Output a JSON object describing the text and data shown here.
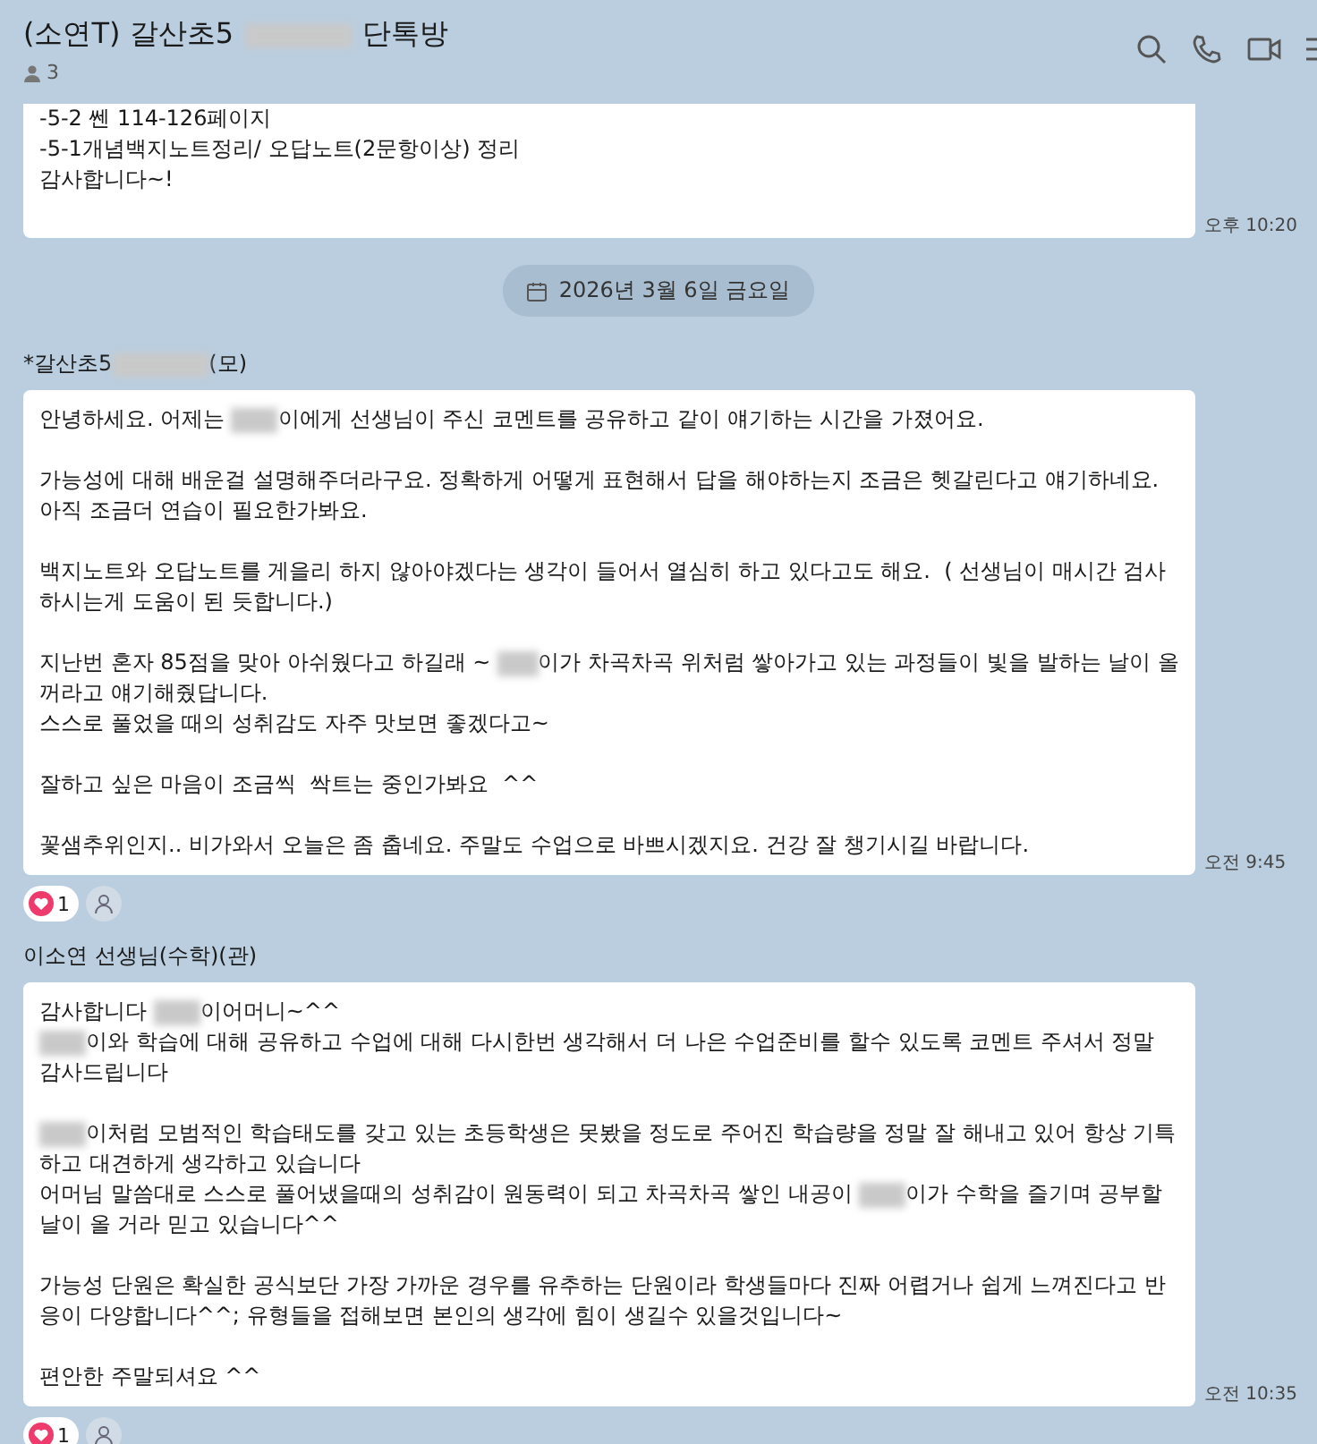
{
  "header": {
    "title": [
      {
        "kind": "text",
        "text": "(소연T) 갈산초5"
      },
      {
        "kind": "redacted"
      },
      {
        "kind": "text",
        "text": "단톡방"
      }
    ],
    "member_count": "3"
  },
  "messages": [
    {
      "kind": "continued",
      "lines": [
        [
          {
            "kind": "text",
            "text": "-5-2 쎈 114-126페이지"
          }
        ],
        [
          {
            "kind": "text",
            "text": "-5-1개념백지노트정리/ 오답노트(2문항이상) 정리"
          }
        ],
        [
          {
            "kind": "text",
            "text": "감사합니다~!"
          }
        ]
      ],
      "time": "오후 10:20"
    },
    {
      "kind": "date",
      "text": "2026년 3월 6일 금요일"
    },
    {
      "kind": "message",
      "sender": [
        {
          "kind": "text",
          "text": "*갈산초5"
        },
        {
          "kind": "redacted"
        },
        {
          "kind": "text",
          "text": "(모)"
        }
      ],
      "paragraphs": [
        [
          [
            {
              "kind": "text",
              "text": "안녕하세요. 어제는 "
            },
            {
              "kind": "redacted"
            },
            {
              "kind": "text",
              "text": "이에게 선생님이 주신 코멘트를 공유하고 같이 얘기하는 시간을 가졌어요."
            }
          ]
        ],
        [
          [
            {
              "kind": "text",
              "text": "가능성에 대해 배운걸 설명해주더라구요. 정확하게 어떻게 표현해서 답을 해야하는지 조금은 헷갈린다고 얘기하네요."
            }
          ],
          [
            {
              "kind": "text",
              "text": "아직 조금더 연습이 필요한가봐요."
            }
          ]
        ],
        [
          [
            {
              "kind": "text",
              "text": "백지노트와 오답노트를 게을리 하지 않아야겠다는 생각이 들어서 열심히 하고 있다고도 해요.  ( 선생님이 매시간 검사"
            }
          ],
          [
            {
              "kind": "text",
              "text": "하시는게 도움이 된 듯합니다.)"
            }
          ]
        ],
        [
          [
            {
              "kind": "text",
              "text": "지난번 혼자 85점을 맞아 아쉬웠다고 하길래 ~ "
            },
            {
              "kind": "redacted"
            },
            {
              "kind": "text",
              "text": "이가 차곡차곡 위처럼 쌓아가고 있는 과정들이 빛을 발하는 날이 올"
            }
          ],
          [
            {
              "kind": "text",
              "text": "꺼라고 얘기해줬답니다."
            }
          ],
          [
            {
              "kind": "text",
              "text": "스스로 풀었을 때의 성취감도 자주 맛보면 좋겠다고~"
            }
          ]
        ],
        [
          [
            {
              "kind": "text",
              "text": "잘하고 싶은 마음이 조금씩  싹트는 중인가봐요  ^^"
            }
          ]
        ],
        [
          [
            {
              "kind": "text",
              "text": "꽃샘추위인지.. 비가와서 오늘은 좀 춥네요. 주말도 수업으로 바쁘시겠지요. 건강 잘 챙기시길 바랍니다."
            }
          ]
        ]
      ],
      "time": "오전 9:45",
      "reaction_count": "1"
    },
    {
      "kind": "message",
      "sender": [
        {
          "kind": "text",
          "text": "이소연 선생님(수학)(관)"
        }
      ],
      "paragraphs": [
        [
          [
            {
              "kind": "text",
              "text": "감사합니다 "
            },
            {
              "kind": "redacted"
            },
            {
              "kind": "text",
              "text": "이어머니~^^"
            }
          ],
          [
            {
              "kind": "redacted"
            },
            {
              "kind": "text",
              "text": "이와 학습에 대해 공유하고 수업에 대해 다시한번 생각해서 더 나은 수업준비를 할수 있도록 코멘트 주셔서 정말"
            }
          ],
          [
            {
              "kind": "text",
              "text": "감사드립니다"
            }
          ]
        ],
        [
          [
            {
              "kind": "redacted"
            },
            {
              "kind": "text",
              "text": "이처럼 모범적인 학습태도를 갖고 있는 초등학생은 못봤을 정도로 주어진 학습량을 정말 잘 해내고 있어 항상 기특"
            }
          ],
          [
            {
              "kind": "text",
              "text": "하고 대견하게 생각하고 있습니다"
            }
          ],
          [
            {
              "kind": "text",
              "text": "어머님 말씀대로 스스로 풀어냈을때의 성취감이 원동력이 되고 차곡차곡 쌓인 내공이 "
            },
            {
              "kind": "redacted"
            },
            {
              "kind": "text",
              "text": "이가 수학을 즐기며 공부할"
            }
          ],
          [
            {
              "kind": "text",
              "text": "날이 올 거라 믿고 있습니다^^"
            }
          ]
        ],
        [
          [
            {
              "kind": "text",
              "text": "가능성 단원은 확실한 공식보단 가장 가까운 경우를 유추하는 단원이라 학생들마다 진짜 어렵거나 쉽게 느껴진다고 반"
            }
          ],
          [
            {
              "kind": "text",
              "text": "응이 다양합니다^^; 유형들을 접해보면 본인의 생각에 힘이 생길수 있을것입니다~"
            }
          ]
        ],
        [
          [
            {
              "kind": "text",
              "text": "편안한 주말되셔요 ^^"
            }
          ]
        ]
      ],
      "time": "오전 10:35",
      "reaction_count": "1"
    }
  ]
}
